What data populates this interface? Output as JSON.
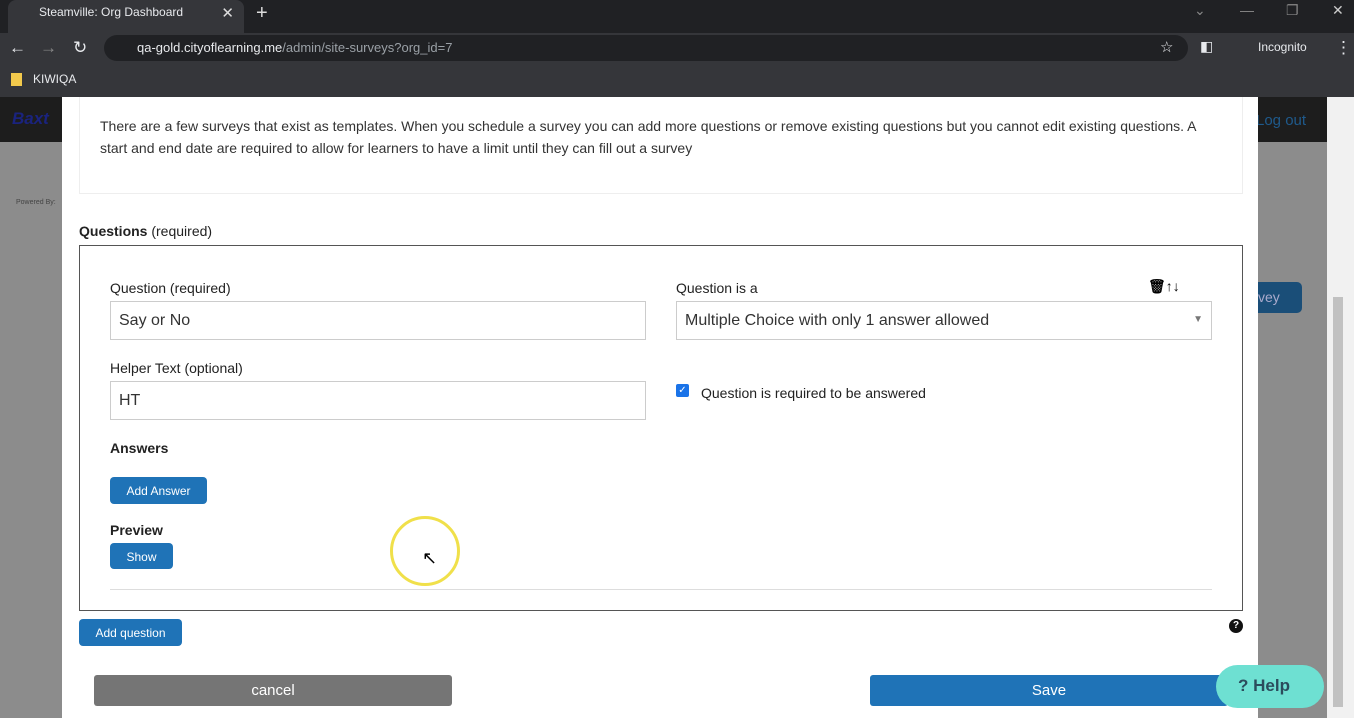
{
  "browser": {
    "tab_title": "Steamville: Org Dashboard",
    "url_host": "qa-gold.cityoflearning.me",
    "url_path": "/admin/site-surveys?org_id=7",
    "profile": "Incognito",
    "bookmark": "KIWIQA"
  },
  "background": {
    "logo": "Baxt",
    "logout": "Log out",
    "powered": "Powered By:",
    "survey_btn": "vey"
  },
  "intro": "There are a few surveys that exist as templates. When you schedule a survey you can add more questions or remove existing questions but you cannot edit existing questions. A start and end date are required to allow for learners to have a limit until they can fill out a survey",
  "questions": {
    "label": "Questions",
    "req": "(required)",
    "question_label": "Question (required)",
    "question_value": "Say or No",
    "type_label": "Question is a",
    "type_value": "Multiple Choice with only 1 answer allowed",
    "helper_label": "Helper Text (optional)",
    "helper_value": "HT",
    "required_label": "Question is required to be answered",
    "required_checked": true,
    "answers_label": "Answers",
    "add_answer": "Add Answer",
    "preview_label": "Preview",
    "show": "Show"
  },
  "add_question": "Add question",
  "cancel": "cancel",
  "save": "Save",
  "help": "Help",
  "colors": {
    "primary": "#1f73b7",
    "cancel": "#757575",
    "help": "#6ee0d2"
  }
}
